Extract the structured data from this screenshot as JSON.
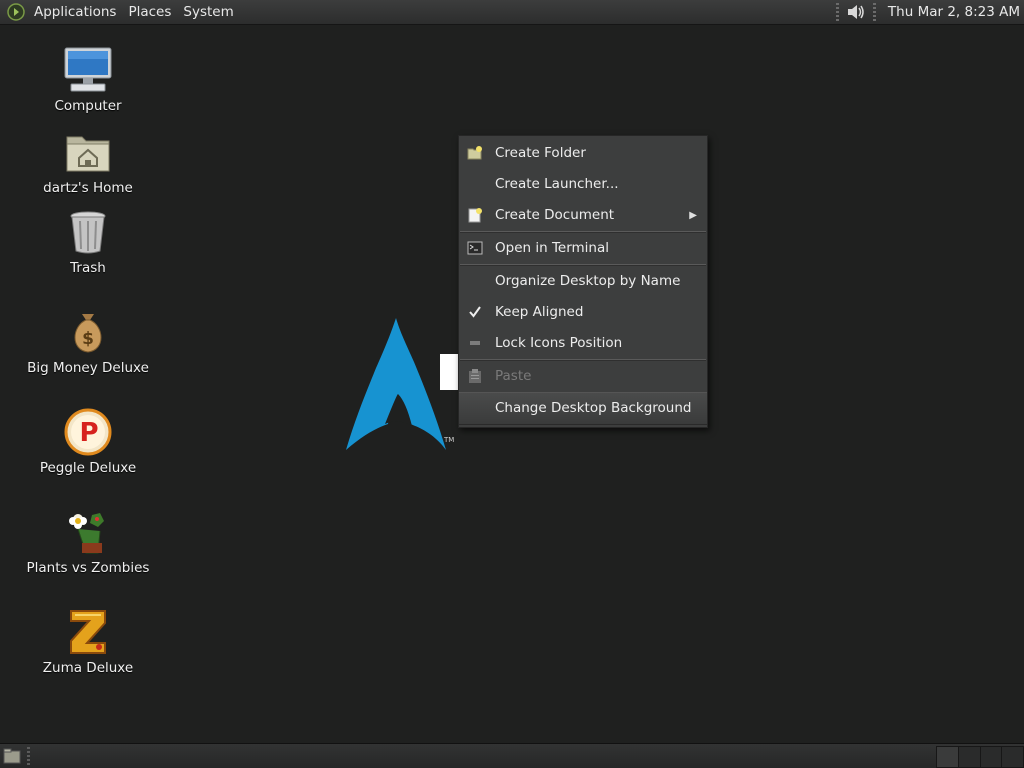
{
  "top_panel": {
    "menus": [
      "Applications",
      "Places",
      "System"
    ],
    "clock": "Thu Mar  2,  8:23 AM"
  },
  "desktop_icons": [
    {
      "label": "Computer",
      "icon": "computer-icon"
    },
    {
      "label": "dartz's Home",
      "icon": "home-folder-icon"
    },
    {
      "label": "Trash",
      "icon": "trash-icon"
    },
    {
      "label": "Big Money Deluxe",
      "icon": "money-bag-icon"
    },
    {
      "label": "Peggle Deluxe",
      "icon": "peggle-icon"
    },
    {
      "label": "Plants vs Zombies",
      "icon": "plants-vs-zombies-icon"
    },
    {
      "label": "Zuma Deluxe",
      "icon": "zuma-icon"
    }
  ],
  "context_menu": {
    "items": [
      {
        "label": "Create Folder",
        "icon": "folder-new-icon"
      },
      {
        "label": "Create Launcher...",
        "icon": ""
      },
      {
        "label": "Create Document",
        "icon": "document-new-icon",
        "submenu": true
      },
      {
        "label": "Open in Terminal",
        "icon": "terminal-icon"
      },
      {
        "label": "Organize Desktop by Name",
        "icon": ""
      },
      {
        "label": "Keep Aligned",
        "icon": "check-icon",
        "checked": true
      },
      {
        "label": "Lock Icons Position",
        "icon": "checkbox-off-icon",
        "checked": false
      },
      {
        "label": "Paste",
        "icon": "paste-icon",
        "disabled": true
      },
      {
        "label": "Change Desktop Background",
        "icon": "",
        "selected": true
      }
    ]
  },
  "colors": {
    "desktop_bg": "#1f201f",
    "arch_blue": "#1793d1",
    "menu_bg": "#3d3e3e"
  }
}
